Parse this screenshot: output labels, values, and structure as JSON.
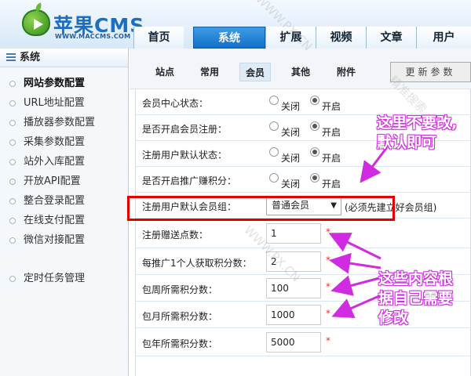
{
  "brand": {
    "name": "苹果CMS",
    "site": "WWW.MACCMS.COM"
  },
  "nav": {
    "tabs": [
      {
        "label": "首页"
      },
      {
        "label": "系统"
      },
      {
        "label": "扩展"
      },
      {
        "label": "视频"
      },
      {
        "label": "文章"
      },
      {
        "label": "用户"
      }
    ]
  },
  "sidebar": {
    "title": "系统",
    "items": [
      {
        "label": "网站参数配置"
      },
      {
        "label": "URL地址配置"
      },
      {
        "label": "播放器参数配置"
      },
      {
        "label": "采集参数配置"
      },
      {
        "label": "站外入库配置"
      },
      {
        "label": "开放API配置"
      },
      {
        "label": "整合登录配置"
      },
      {
        "label": "在线支付配置"
      },
      {
        "label": "微信对接配置"
      },
      {
        "label": "定时任务管理"
      }
    ]
  },
  "subnav": {
    "tabs": [
      {
        "label": "站点"
      },
      {
        "label": "常用"
      },
      {
        "label": "会员"
      },
      {
        "label": "其他"
      },
      {
        "label": "附件"
      }
    ],
    "update_label": "更新参数"
  },
  "form": {
    "off": "关闭",
    "on": "开启",
    "rows": [
      {
        "label": "会员中心状态："
      },
      {
        "label": "是否开启会员注册："
      },
      {
        "label": "注册用户默认状态："
      },
      {
        "label": "是否开启推广赚积分："
      },
      {
        "label": "注册用户默认会员组：",
        "value": "普通会员",
        "hint": "(必须先建立好会员组)"
      },
      {
        "label": "注册赠送点数：",
        "value": "1"
      },
      {
        "label": "每推广1个人获取积分数：",
        "value": "2"
      },
      {
        "label": "包周所需积分数：",
        "value": "100"
      },
      {
        "label": "包月所需积分数：",
        "value": "1000"
      },
      {
        "label": "包年所需积分数：",
        "value": "5000"
      }
    ],
    "required": "*"
  },
  "annotations": {
    "top": [
      "这里不要改,",
      "默认即可"
    ],
    "bottom": [
      "这些内容根",
      "据自己需要",
      "修改"
    ]
  },
  "watermarks": [
    "精准搜索",
    "WWW.PX.CN",
    "WWW.PX.CN"
  ],
  "colors": {
    "accent": "#116fc8",
    "annotation": "#d12be1",
    "highlight": "#e00000"
  }
}
